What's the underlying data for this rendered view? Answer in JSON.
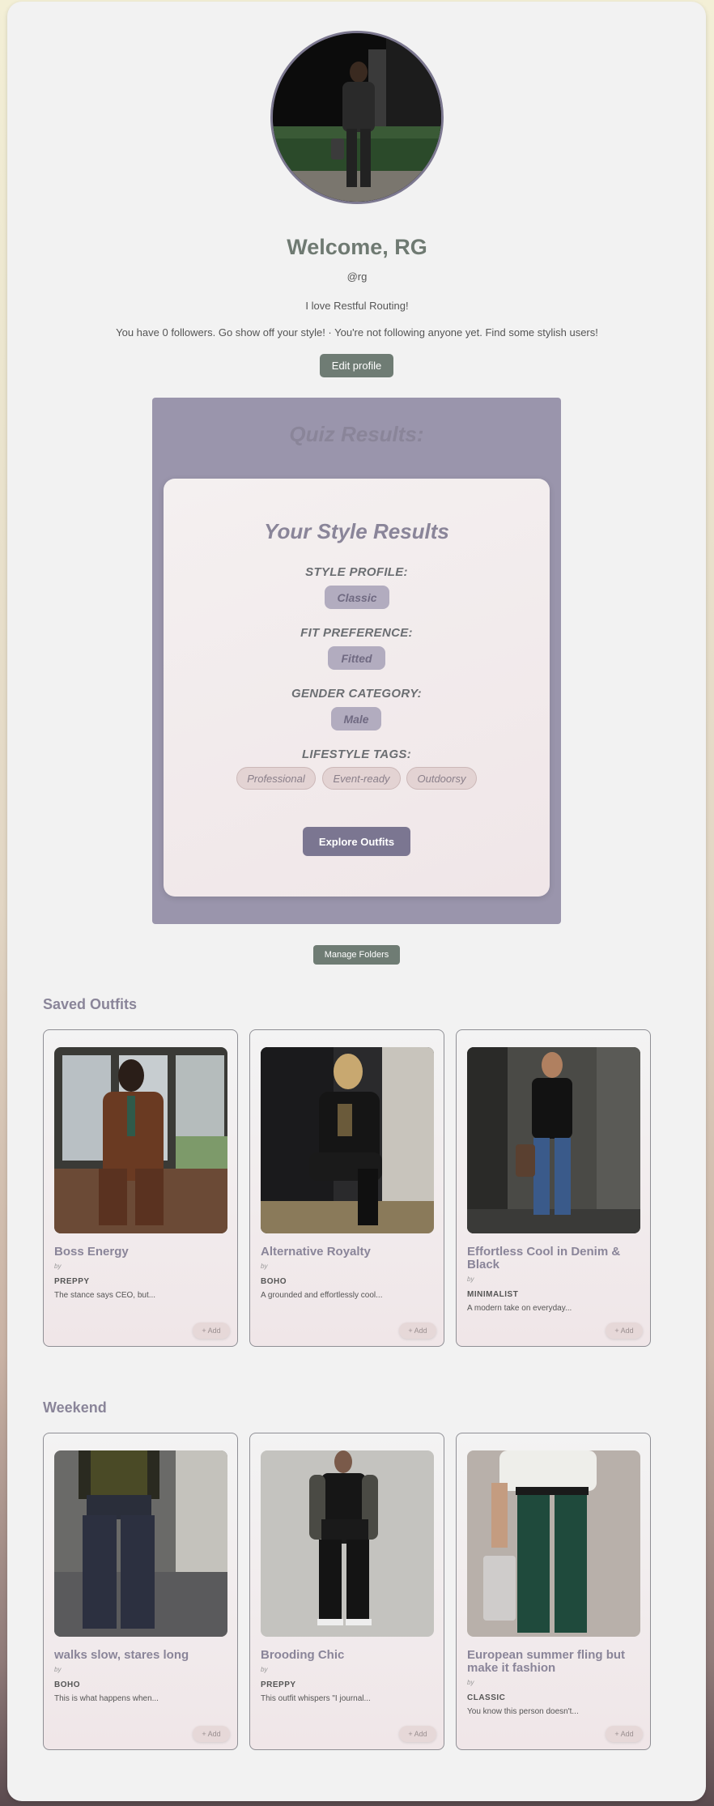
{
  "profile": {
    "welcome": "Welcome, RG",
    "handle": "@rg",
    "bio": "I love Restful Routing!",
    "followers_text": "You have 0 followers. Go show off your style! · You're not following anyone yet. Find some stylish users!",
    "edit_label": "Edit profile"
  },
  "quiz": {
    "title": "Quiz Results:",
    "card_title": "Your Style Results",
    "style_profile_label": "STYLE PROFILE:",
    "style_profile_value": "Classic",
    "fit_label": "FIT PREFERENCE:",
    "fit_value": "Fitted",
    "gender_label": "GENDER CATEGORY:",
    "gender_value": "Male",
    "lifestyle_label": "LIFESTYLE TAGS:",
    "lifestyle_tags": [
      "Professional",
      "Event-ready",
      "Outdoorsy"
    ],
    "explore_label": "Explore Outfits"
  },
  "manage_folders_label": "Manage Folders",
  "folders": [
    {
      "title": "Saved Outfits",
      "outfits": [
        {
          "name": "Boss Energy",
          "by": "by",
          "style": "PREPPY",
          "desc": "The stance says CEO, but...",
          "add": "+ Add"
        },
        {
          "name": "Alternative Royalty",
          "by": "by",
          "style": "BOHO",
          "desc": "A grounded and effortlessly cool...",
          "add": "+ Add"
        },
        {
          "name": "Effortless Cool in Denim & Black",
          "by": "by",
          "style": "MINIMALIST",
          "desc": "A modern take on everyday...",
          "add": "+ Add"
        }
      ]
    },
    {
      "title": "Weekend",
      "outfits": [
        {
          "name": "walks slow, stares long",
          "by": "by",
          "style": "BOHO",
          "desc": "This is what happens when...",
          "add": "+ Add"
        },
        {
          "name": "Brooding Chic",
          "by": "by",
          "style": "PREPPY",
          "desc": "This outfit whispers \"I journal...",
          "add": "+ Add"
        },
        {
          "name": "European summer fling but make it fashion",
          "by": "by",
          "style": "CLASSIC",
          "desc": "You know this person doesn't...",
          "add": "+ Add"
        }
      ]
    }
  ]
}
